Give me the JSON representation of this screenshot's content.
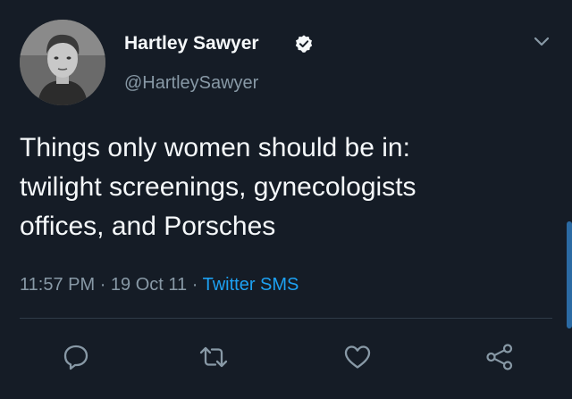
{
  "user": {
    "display_name": "Hartley Sawyer",
    "handle": "@HartleySawyer",
    "verified": true
  },
  "tweet": {
    "lines": [
      "Things only women should be in:",
      "twilight screenings, gynecologists",
      "offices, and Porsches"
    ],
    "time": "11:57 PM",
    "date": "19 Oct 11",
    "separator": "·",
    "source": "Twitter SMS"
  },
  "actions": {
    "reply_icon": "reply-icon",
    "retweet_icon": "retweet-icon",
    "like_icon": "like-icon",
    "share_icon": "share-icon"
  },
  "colors": {
    "background": "#151c26",
    "primary_text": "#f5f8fa",
    "secondary_text": "#8899a6",
    "accent": "#1da1f2"
  }
}
